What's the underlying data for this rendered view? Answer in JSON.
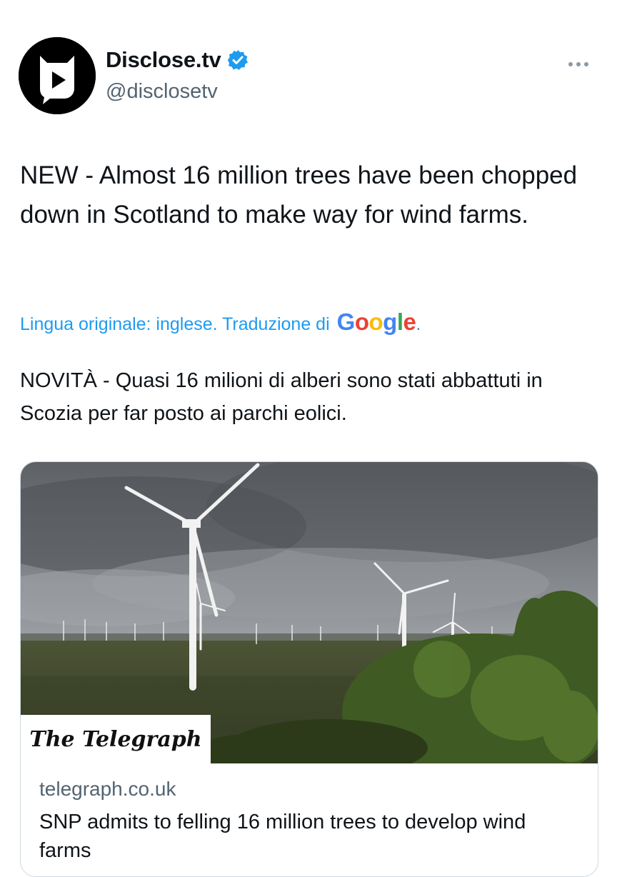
{
  "author": {
    "display_name": "Disclose.tv",
    "handle": "@disclosetv"
  },
  "tweet": {
    "text": "NEW - Almost 16 million trees have been chopped down in Scotland to make way for wind farms.",
    "translation_note": "Lingua originale: inglese. Traduzione di",
    "translation_provider": [
      "G",
      "o",
      "o",
      "g",
      "l",
      "e"
    ],
    "translated_text": "NOVITÀ - Quasi 16 milioni di alberi sono stati abbattuti in Scozia per far posto ai parchi eolici."
  },
  "card": {
    "image_badge": "The Telegraph",
    "domain": "telegraph.co.uk",
    "title": "SNP admits to felling 16 million trees to develop wind farms"
  },
  "icons": {
    "verified": "verified-badge-icon",
    "more": "more-options-icon",
    "avatar": "disclose-tv-logo"
  },
  "colors": {
    "accent": "#1d9bf0",
    "text": "#0f1419",
    "secondary": "#536471"
  }
}
